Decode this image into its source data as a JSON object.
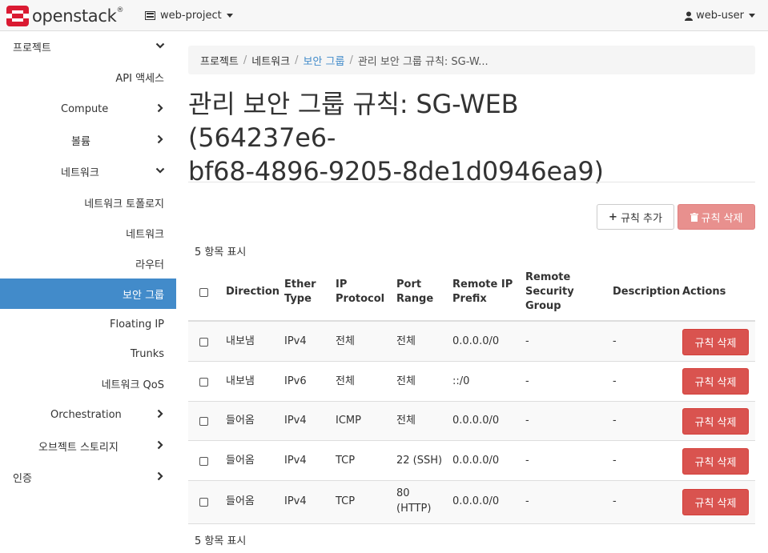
{
  "navbar": {
    "brand": "openstack",
    "brand_mark": "®",
    "project": "web-project",
    "user": "web-user"
  },
  "sidebar": {
    "items": [
      {
        "label": "프로젝트",
        "expanded": true
      },
      {
        "label": "API 액세스"
      },
      {
        "label": "Compute"
      },
      {
        "label": "볼륨"
      },
      {
        "label": "네트워크",
        "expanded": true
      },
      {
        "label": "네트워크 토폴로지"
      },
      {
        "label": "네트워크"
      },
      {
        "label": "라우터"
      },
      {
        "label": "보안 그룹",
        "active": true
      },
      {
        "label": "Floating IP"
      },
      {
        "label": "Trunks"
      },
      {
        "label": "네트워크 QoS"
      },
      {
        "label": "Orchestration"
      },
      {
        "label": "오브젝트 스토리지"
      },
      {
        "label": "인증"
      }
    ]
  },
  "breadcrumb": {
    "items": [
      "프로젝트",
      "네트워크",
      "보안 그룹"
    ],
    "current": "관리 보안 그룹 규칙: SG-W..."
  },
  "page": {
    "title_line1": "관리 보안 그룹 규칙: SG-WEB",
    "title_line2": "(564237e6-",
    "title_line3": "bf68-4896-9205-8de1d0946ea9)",
    "add_rule": "규칙 추가",
    "delete_rules": "규칙 삭제",
    "count_text": "5 항목 표시"
  },
  "table": {
    "headers": {
      "direction": "Direction",
      "ether_type": [
        "Ether",
        "Type"
      ],
      "ip_protocol": [
        "IP",
        "Protocol"
      ],
      "port_range": [
        "Port",
        "Range"
      ],
      "remote_ip": [
        "Remote IP",
        "Prefix"
      ],
      "remote_sg": [
        "Remote",
        "Security",
        "Group"
      ],
      "description": "Description",
      "actions": "Actions"
    },
    "rows": [
      {
        "direction": "내보냄",
        "ether": "IPv4",
        "protocol": "전체",
        "port": "전체",
        "port2": "",
        "remote_ip": "0.0.0.0/0",
        "remote_sg": "-",
        "description": "-",
        "action": "규칙 삭제"
      },
      {
        "direction": "내보냄",
        "ether": "IPv6",
        "protocol": "전체",
        "port": "전체",
        "port2": "",
        "remote_ip": "::/0",
        "remote_sg": "-",
        "description": "-",
        "action": "규칙 삭제"
      },
      {
        "direction": "들어옴",
        "ether": "IPv4",
        "protocol": "ICMP",
        "port": "전체",
        "port2": "",
        "remote_ip": "0.0.0.0/0",
        "remote_sg": "-",
        "description": "-",
        "action": "규칙 삭제"
      },
      {
        "direction": "들어옴",
        "ether": "IPv4",
        "protocol": "TCP",
        "port": "22 (SSH)",
        "port2": "",
        "remote_ip": "0.0.0.0/0",
        "remote_sg": "-",
        "description": "-",
        "action": "규칙 삭제"
      },
      {
        "direction": "들어옴",
        "ether": "IPv4",
        "protocol": "TCP",
        "port": "80",
        "port2": "(HTTP)",
        "remote_ip": "0.0.0.0/0",
        "remote_sg": "-",
        "description": "-",
        "action": "규칙 삭제"
      }
    ]
  },
  "colors": {
    "active": "#428bca",
    "danger": "#d9534f",
    "danger_disabled": "#e8908e",
    "logo": "#da1a32"
  }
}
